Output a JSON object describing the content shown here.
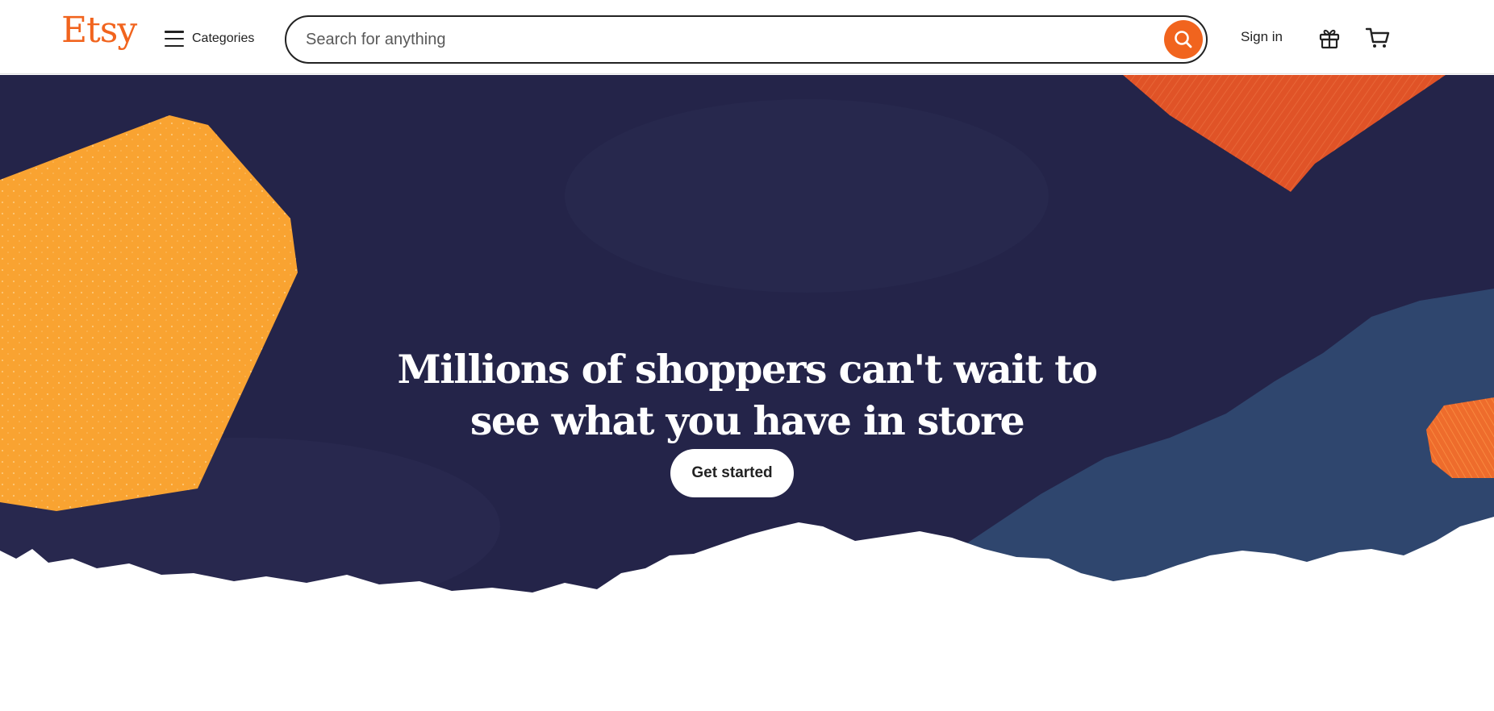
{
  "header": {
    "logo": "Etsy",
    "categories_label": "Categories",
    "search_placeholder": "Search for anything",
    "signin_label": "Sign in"
  },
  "icons": {
    "menu": "hamburger-menu-icon",
    "search": "search-icon",
    "gift": "gift-icon",
    "cart": "cart-icon"
  },
  "hero": {
    "headline_line1": "Millions of shoppers can't wait to",
    "headline_line2": "see what you have in store",
    "cta_label": "Get started"
  },
  "colors": {
    "brand_orange": "#f1641e",
    "hero_navy": "#242449",
    "shape_yellow": "#f9a331",
    "shape_blue": "#2f466e",
    "shape_orange_red": "#e05327"
  }
}
